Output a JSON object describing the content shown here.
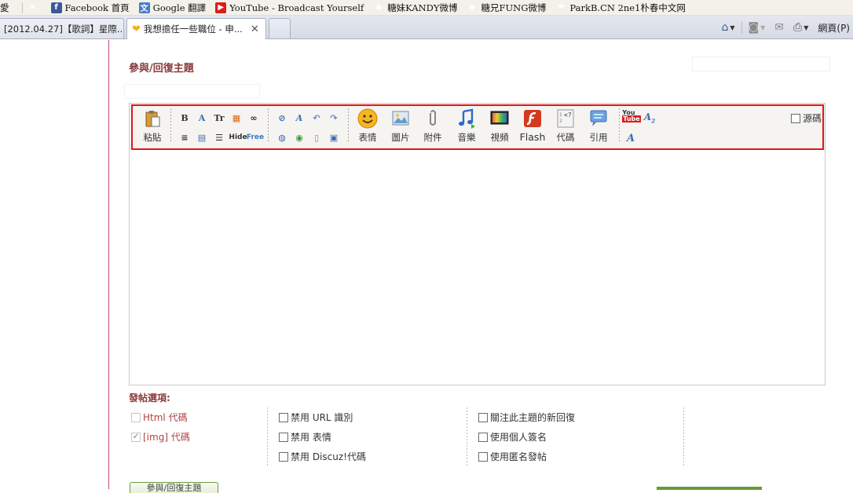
{
  "bookmarks": {
    "items": [
      {
        "label": "愛",
        "icon": "text-fragment"
      },
      {
        "label": "Facebook 首頁",
        "icon": "facebook-icon"
      },
      {
        "label": "Google 翻譯",
        "icon": "google-translate-icon"
      },
      {
        "label": "YouTube - Broadcast Yourself",
        "icon": "youtube-icon"
      },
      {
        "label": "糖妹KANDY微博",
        "icon": "weibo-icon"
      },
      {
        "label": "糖兄FUNG微博",
        "icon": "weibo-icon"
      },
      {
        "label": "ParkB.CN 2ne1朴春中文网",
        "icon": "parkb-icon"
      }
    ]
  },
  "tabs": {
    "items": [
      {
        "label": "[2012.04.27]【歌詞】星際..."
      },
      {
        "label": "我想擔任一些職位 - 申..."
      }
    ],
    "right_tools": {
      "page_label": "網頁(P)"
    }
  },
  "page": {
    "section_title": "參與/回復主題"
  },
  "toolbar": {
    "paste_label": "粘貼",
    "small_row1": [
      "B",
      "A",
      "Tr",
      "▦",
      "∞"
    ],
    "small_row2": [
      "≡",
      "▤",
      "☰",
      "Hide",
      "Free"
    ],
    "buttons": [
      {
        "name": "emoticon",
        "label": "表情"
      },
      {
        "name": "image",
        "label": "圖片"
      },
      {
        "name": "attachment",
        "label": "附件"
      },
      {
        "name": "music",
        "label": "音樂"
      },
      {
        "name": "video",
        "label": "視頻"
      },
      {
        "name": "flash",
        "label": "Flash"
      },
      {
        "name": "code",
        "label": "代碼"
      },
      {
        "name": "quote",
        "label": "引用"
      }
    ],
    "source_label": "源碼"
  },
  "options": {
    "title": "發帖選項:",
    "col1": [
      {
        "label": "Html 代碼",
        "checked": false,
        "disabled": true
      },
      {
        "label": "[img] 代碼",
        "checked": true,
        "disabled": true
      }
    ],
    "col2": [
      {
        "label": "禁用 URL 識別",
        "checked": false
      },
      {
        "label": "禁用 表情",
        "checked": false
      },
      {
        "label": "禁用 Discuz!代碼",
        "checked": false
      }
    ],
    "col3": [
      {
        "label": "關注此主題的新回復",
        "checked": false
      },
      {
        "label": "使用個人簽名",
        "checked": false
      },
      {
        "label": "使用匿名發帖",
        "checked": false
      }
    ]
  },
  "submit": {
    "label": "參與/回復主題"
  }
}
